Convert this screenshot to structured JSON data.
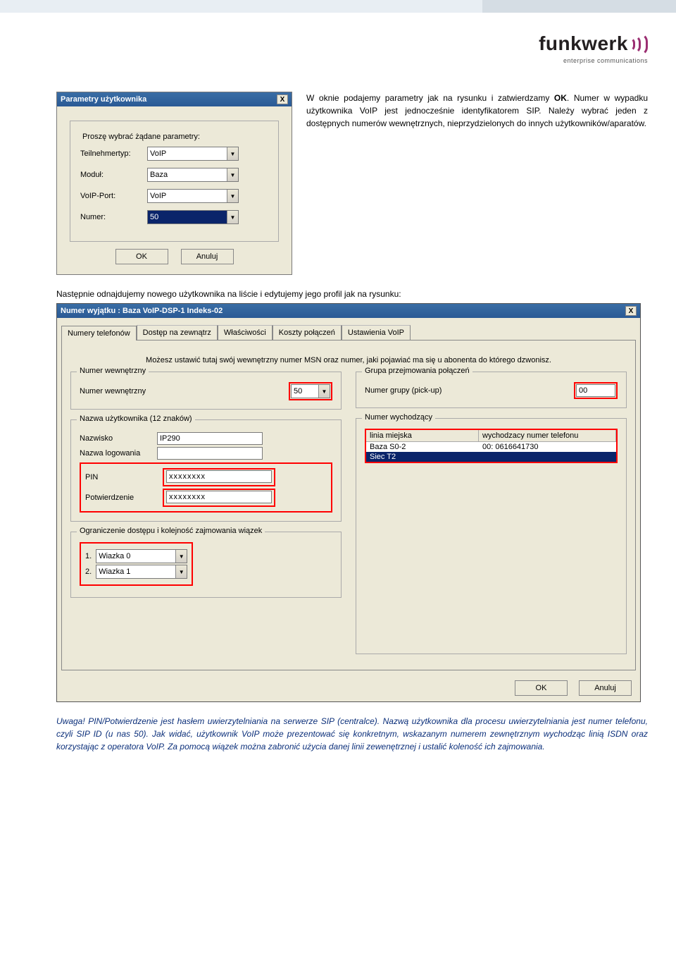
{
  "logo": {
    "word": "funkwerk",
    "tagline": "enterprise communications"
  },
  "para1_a": "W oknie podajemy parametry jak na rysunku i zatwierdzamy ",
  "para1_b": "OK",
  "para1_c": ". Numer w wypadku użytkownika VoIP jest jednocześnie identyfikatorem SIP. Należy wybrać jeden z dostępnych numerów wewnętrznych, nieprzydzielonych do innych użytkowników/aparatów.",
  "dialog1": {
    "title": "Parametry użytkownika",
    "close": "X",
    "legend": "Proszę wybrać żądane parametry:",
    "fields": {
      "teilnehmertyp_label": "Teilnehmertyp:",
      "teilnehmertyp_value": "VoIP",
      "modul_label": "Moduł:",
      "modul_value": "Baza",
      "voipport_label": "VoIP-Port:",
      "voipport_value": "VoIP",
      "numer_label": "Numer:",
      "numer_value": "50"
    },
    "ok": "OK",
    "cancel": "Anuluj"
  },
  "mid_text": "Następnie odnajdujemy nowego użytkownika na liście i edytujemy jego profil jak na rysunku:",
  "dialog2": {
    "title": "Numer wyjątku : Baza VoIP-DSP-1 Indeks-02",
    "close": "X",
    "tabs": [
      "Numery telefonów",
      "Dostęp na zewnątrz",
      "Właściwości",
      "Koszty połączeń",
      "Ustawienia VoIP"
    ],
    "info": "Możesz ustawić tutaj swój wewnętrzny numer MSN oraz numer, jaki pojawiać ma się u abonenta do którego dzwonisz.",
    "grp_numwew_title": "Numer wewnętrzny",
    "numwew_label": "Numer wewnętrzny",
    "numwew_value": "50",
    "grp_grupa_title": "Grupa przejmowania połączeń",
    "grupa_label": "Numer grupy (pick-up)",
    "grupa_value": "00",
    "grp_nazwa_title": "Nazwa użytkownika (12 znaków)",
    "nazwisko_label": "Nazwisko",
    "nazwisko_value": "IP290",
    "login_label": "Nazwa logowania",
    "login_value": "",
    "pin_label": "PIN",
    "pin_value": "xxxxxxxx",
    "potw_label": "Potwierdzenie",
    "potw_value": "xxxxxxxx",
    "grp_wych_title": "Numer wychodzący",
    "list_hdr1": "linia miejska",
    "list_hdr2": "wychodzacy numer telefonu",
    "list_r1c1": "Baza S0-2",
    "list_r1c2": "00: 0616641730",
    "list_r2c1": "Siec T2",
    "list_r2c2": "",
    "grp_ogr_title": "Ograniczenie dostępu i kolejność zajmowania wiązek",
    "w1_label": "1.",
    "w1_value": "Wiazka 0",
    "w2_label": "2.",
    "w2_value": "Wiazka 1",
    "ok": "OK",
    "cancel": "Anuluj"
  },
  "note": "Uwaga! PIN/Potwierdzenie jest hasłem uwierzytelniania na serwerze SIP (centralce). Nazwą użytkownika dla procesu uwierzytelniania jest numer telefonu, czyli SIP ID (u nas 50). Jak widać, użytkownik VoIP może prezentować się konkretnym, wskazanym numerem zewnętrznym wychodząc linią ISDN oraz korzystając z operatora VoIP. Za pomocą wiązek można zabronić użycia danej linii zewenętrznej i ustalić koleność ich zajmowania."
}
